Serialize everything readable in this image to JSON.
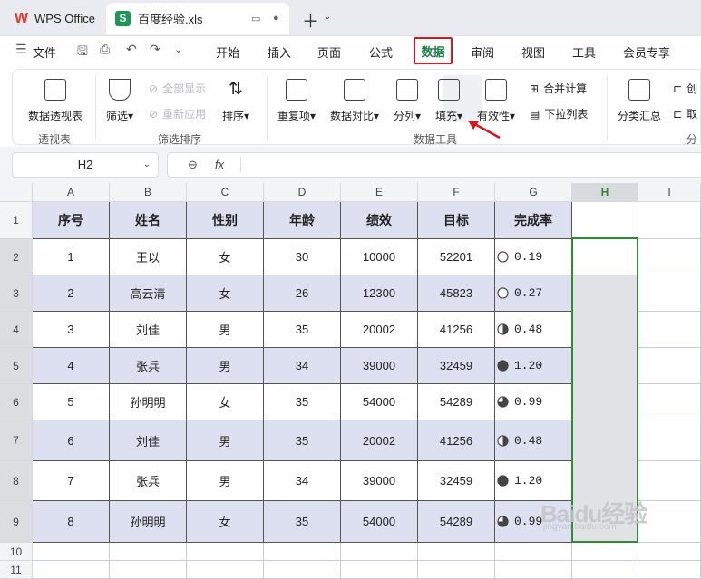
{
  "app": {
    "name": "WPS Office",
    "file_tab": "百度经验.xls"
  },
  "menu": {
    "file": "文件",
    "tabs": [
      "开始",
      "插入",
      "页面",
      "公式",
      "数据",
      "审阅",
      "视图",
      "工具",
      "会员专享"
    ],
    "active": "数据"
  },
  "ribbon": {
    "pivot": "数据透视表",
    "filter": "筛选",
    "show_all": "全部显示",
    "reapply": "重新应用",
    "sort": "排序",
    "duplicates": "重复项",
    "compare": "数据对比",
    "split": "分列",
    "fill": "填充",
    "validity": "有效性",
    "consolidate": "合并计算",
    "dropdown_list": "下拉列表",
    "subtotal": "分类汇总",
    "create_group": "创",
    "cancel_group": "取",
    "groups": {
      "pivot": "透视表",
      "filter_sort": "筛选排序",
      "data_tools": "数据工具",
      "outline": "分"
    }
  },
  "formula_bar": {
    "name_box": "H2",
    "fx": "fx",
    "formula": ""
  },
  "grid": {
    "columns": [
      "A",
      "B",
      "C",
      "D",
      "E",
      "F",
      "G",
      "H",
      "I"
    ],
    "rows": [
      "1",
      "2",
      "3",
      "4",
      "5",
      "6",
      "7",
      "8",
      "9",
      "10",
      "11"
    ],
    "headers": [
      "序号",
      "姓名",
      "性别",
      "年龄",
      "绩效",
      "目标",
      "完成率"
    ],
    "data": [
      [
        "1",
        "王以",
        "女",
        "30",
        "10000",
        "52201",
        "0.19"
      ],
      [
        "2",
        "高云清",
        "女",
        "26",
        "12300",
        "45823",
        "0.27"
      ],
      [
        "3",
        "刘佳",
        "男",
        "35",
        "20002",
        "41256",
        "0.48"
      ],
      [
        "4",
        "张兵",
        "男",
        "34",
        "39000",
        "32459",
        "1.20"
      ],
      [
        "5",
        "孙明明",
        "女",
        "35",
        "54000",
        "54289",
        "0.99"
      ],
      [
        "6",
        "刘佳",
        "男",
        "35",
        "20002",
        "41256",
        "0.48"
      ],
      [
        "7",
        "张兵",
        "男",
        "34",
        "39000",
        "32459",
        "1.20"
      ],
      [
        "8",
        "孙明明",
        "女",
        "35",
        "54000",
        "54289",
        "0.99"
      ]
    ],
    "rate_icon_fill": [
      0,
      0,
      0.5,
      1,
      0.75,
      0.5,
      1,
      0.75
    ],
    "selected_cell": "H2"
  },
  "watermark": {
    "text": "Baidu经验",
    "sub": "jingyan.baidu.com"
  },
  "colors": {
    "accent_green": "#1a7c46",
    "highlight_red": "#d9181e",
    "selection": "#2f8a34",
    "band": "#dde0f0"
  }
}
